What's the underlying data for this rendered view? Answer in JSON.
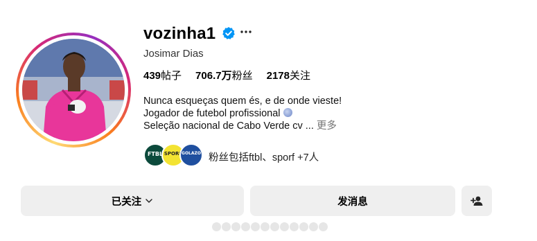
{
  "profile": {
    "username": "vozinha1",
    "full_name": "Josimar Dias",
    "verified_icon": "verified-badge-icon",
    "more_icon": "more-options-icon"
  },
  "stats": {
    "posts_count": "439",
    "posts_label": "帖子",
    "followers_count": "706.7万",
    "followers_label": "粉丝",
    "following_count": "2178",
    "following_label": "关注"
  },
  "bio": {
    "line1": "Nunca esqueças quem és, e de onde vieste!",
    "line2": "Jogador de futebol profissional",
    "line3": "Seleção nacional de Cabo Verde cv ...",
    "more_label": "更多"
  },
  "followed_by": {
    "avatars": [
      {
        "label": "FTBL",
        "color": "#0c4a3c"
      },
      {
        "label": "SPORF",
        "color": "#f3e332"
      },
      {
        "label": "GOLAZO",
        "color": "#1f4f9f"
      }
    ],
    "text": "粉丝包括ftbl、sporf +7人"
  },
  "actions": {
    "following_label": "已关注",
    "message_label": "发消息",
    "suggest_icon": "add-person-icon"
  },
  "colors": {
    "verified": "#0095f6",
    "button_bg": "#efefef",
    "muted_text": "#737373"
  }
}
